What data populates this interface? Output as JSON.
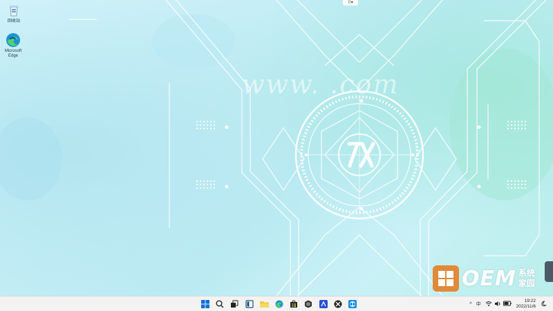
{
  "desktop": {
    "icons": [
      {
        "label": "回收站",
        "icon": "recycle-bin-icon"
      },
      {
        "label": "Microsoft Edge",
        "icon": "edge-icon"
      }
    ]
  },
  "wallpaper": {
    "watermark": "www.      .com"
  },
  "branding": {
    "logo_text": "OEM",
    "logo_cn_line1": "系统",
    "logo_cn_line2": "家园"
  },
  "taskbar": {
    "pinned": [
      {
        "name": "start",
        "icon": "windows-start-icon"
      },
      {
        "name": "search",
        "icon": "search-icon"
      },
      {
        "name": "task-view",
        "icon": "task-view-icon"
      },
      {
        "name": "widgets",
        "icon": "widgets-icon"
      },
      {
        "name": "file-explorer",
        "icon": "folder-icon"
      },
      {
        "name": "edge",
        "icon": "edge-icon"
      },
      {
        "name": "store",
        "icon": "store-icon"
      },
      {
        "name": "app-dark",
        "icon": "cube-icon"
      },
      {
        "name": "app-blue",
        "icon": "blue-app-icon"
      },
      {
        "name": "xbox",
        "icon": "xbox-icon"
      },
      {
        "name": "teamviewer",
        "icon": "teamviewer-icon"
      }
    ],
    "tray": {
      "chevron": "^",
      "ime": "中",
      "time": "19:22",
      "date": "2022/11/6"
    }
  },
  "colors": {
    "taskbar_bg": "#f3f3f3",
    "start_blue": "#0a6fd6",
    "oem_orange": "#e08a3a"
  }
}
